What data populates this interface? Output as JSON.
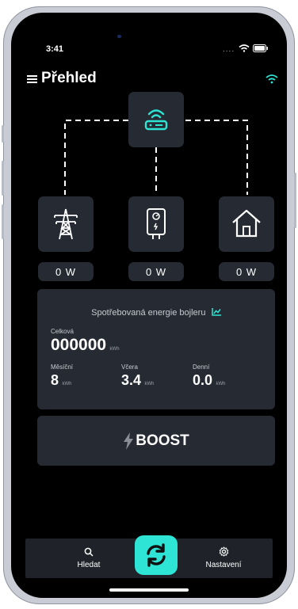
{
  "status_bar": {
    "time": "3:41",
    "dots": "...."
  },
  "header": {
    "title": "Přehled"
  },
  "power": {
    "grid": "0 W",
    "boiler": "0 W",
    "home": "0 W"
  },
  "energy": {
    "title": "Spotřebovaná energie bojleru",
    "total_label": "Celková",
    "total_value": "000000",
    "total_unit": "kWh",
    "monthly_label": "Měsíční",
    "monthly_value": "8",
    "monthly_unit": "kWh",
    "yesterday_label": "Včera",
    "yesterday_value": "3.4",
    "yesterday_unit": "kWh",
    "daily_label": "Denní",
    "daily_value": "0.0",
    "daily_unit": "kWh"
  },
  "boost": {
    "label": "BOOST"
  },
  "nav": {
    "search_label": "Hledat",
    "settings_label": "Nastavení"
  },
  "colors": {
    "accent": "#2ee4d4",
    "card": "#262b33",
    "background": "#000000"
  },
  "icons": [
    "menu-icon",
    "wifi-icon",
    "router-icon",
    "pylon-icon",
    "boiler-icon",
    "house-icon",
    "chart-icon",
    "bolt-icon",
    "search-icon",
    "refresh-icon",
    "gear-icon"
  ]
}
